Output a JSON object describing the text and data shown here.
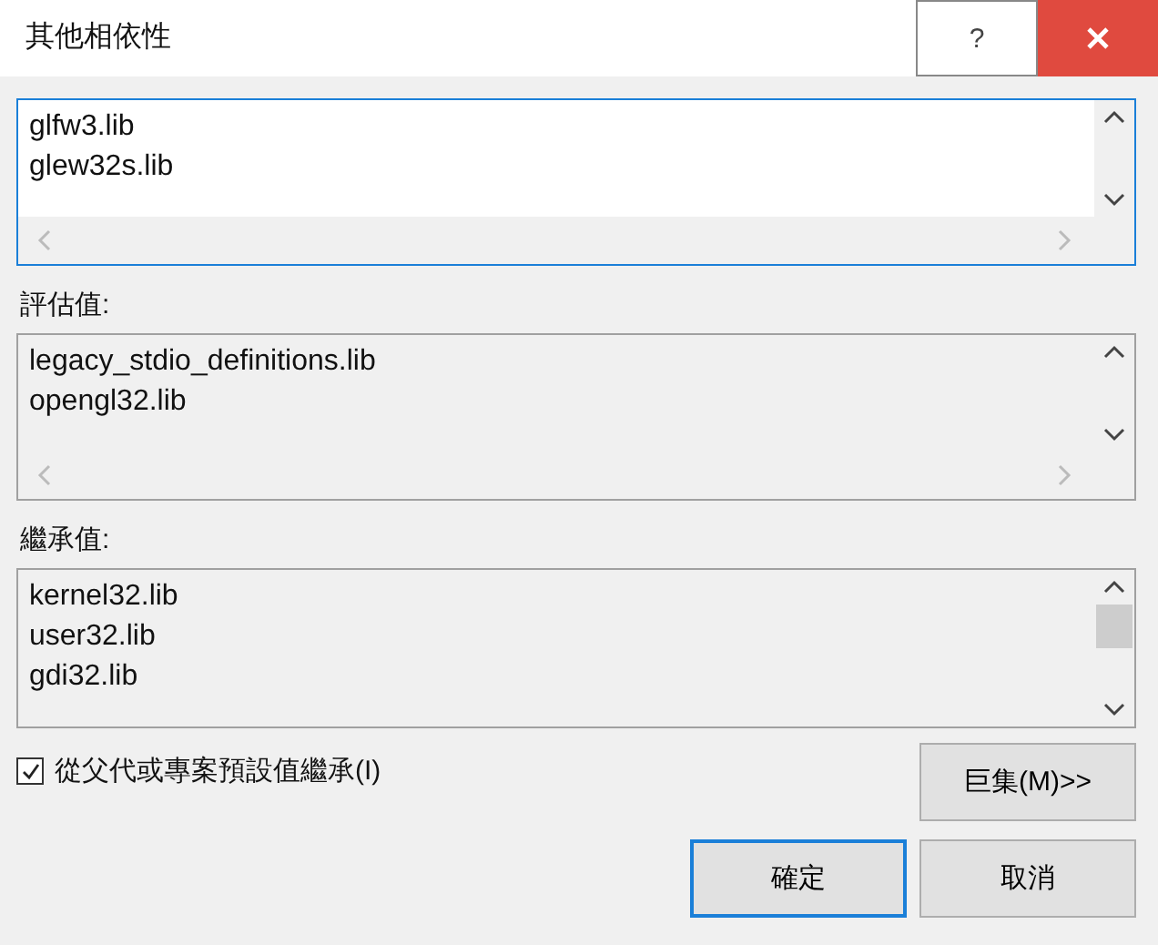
{
  "window": {
    "title": "其他相依性",
    "help_button": "?"
  },
  "boxes": [
    {
      "kind": "edit",
      "focused": true,
      "horizontal_scrollbar": true,
      "lines": [
        "glfw3.lib",
        "glew32s.lib"
      ]
    },
    {
      "label": "評估值:",
      "kind": "readonly",
      "focused": false,
      "horizontal_scrollbar": true,
      "lines": [
        "legacy_stdio_definitions.lib",
        "opengl32.lib"
      ]
    },
    {
      "label": "繼承值:",
      "kind": "readonly",
      "focused": false,
      "horizontal_scrollbar": false,
      "lines": [
        "kernel32.lib",
        "user32.lib",
        "gdi32.lib"
      ]
    }
  ],
  "inherit_checkbox": {
    "label": "從父代或專案預設值繼承(I)",
    "checked": true
  },
  "macro_button": "巨集(M)>>",
  "buttons": [
    {
      "label": "確定",
      "default": true
    },
    {
      "label": "取消",
      "default": false
    }
  ]
}
